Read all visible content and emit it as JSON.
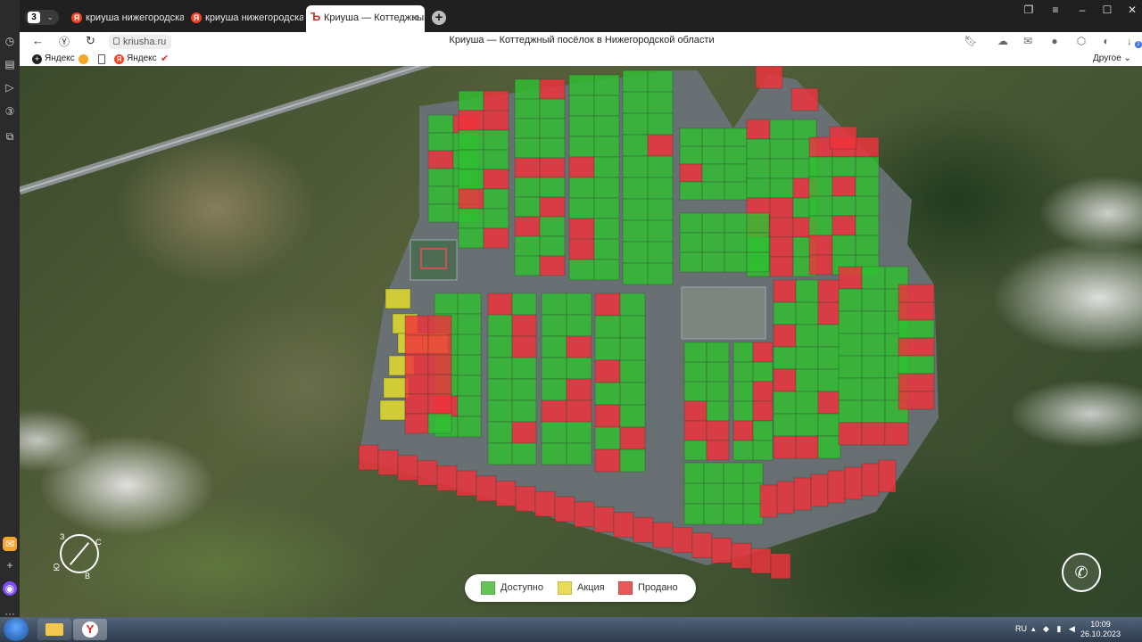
{
  "browser": {
    "workspace_count": "3",
    "tabs": [
      {
        "label": "криуша нижегородская о",
        "active": false
      },
      {
        "label": "криуша нижегородская о",
        "active": false
      },
      {
        "label": "Криуша — Коттеджный",
        "active": true
      }
    ],
    "url": "kriusha.ru",
    "page_title": "Криуша — Коттеджный посёлок в Нижегородской области",
    "bookmarks": [
      "Яндекс",
      "Яндекс"
    ],
    "bookmarks_other": "Другое",
    "notification_count": "2"
  },
  "map": {
    "legend": [
      {
        "label": "Доступно",
        "color": "#66c35a"
      },
      {
        "label": "Акция",
        "color": "#e8dc56"
      },
      {
        "label": "Продано",
        "color": "#e85a5a"
      }
    ],
    "compass_labels": {
      "n": "С",
      "w": "З",
      "s": "Ю",
      "e": "В"
    },
    "colors": {
      "available": "#2fbf2f",
      "promo": "#e6e02a",
      "sold": "#f0323c",
      "road": "#6e7479"
    }
  },
  "taskbar": {
    "lang": "RU",
    "time": "10:09",
    "date": "26.10.2023"
  }
}
